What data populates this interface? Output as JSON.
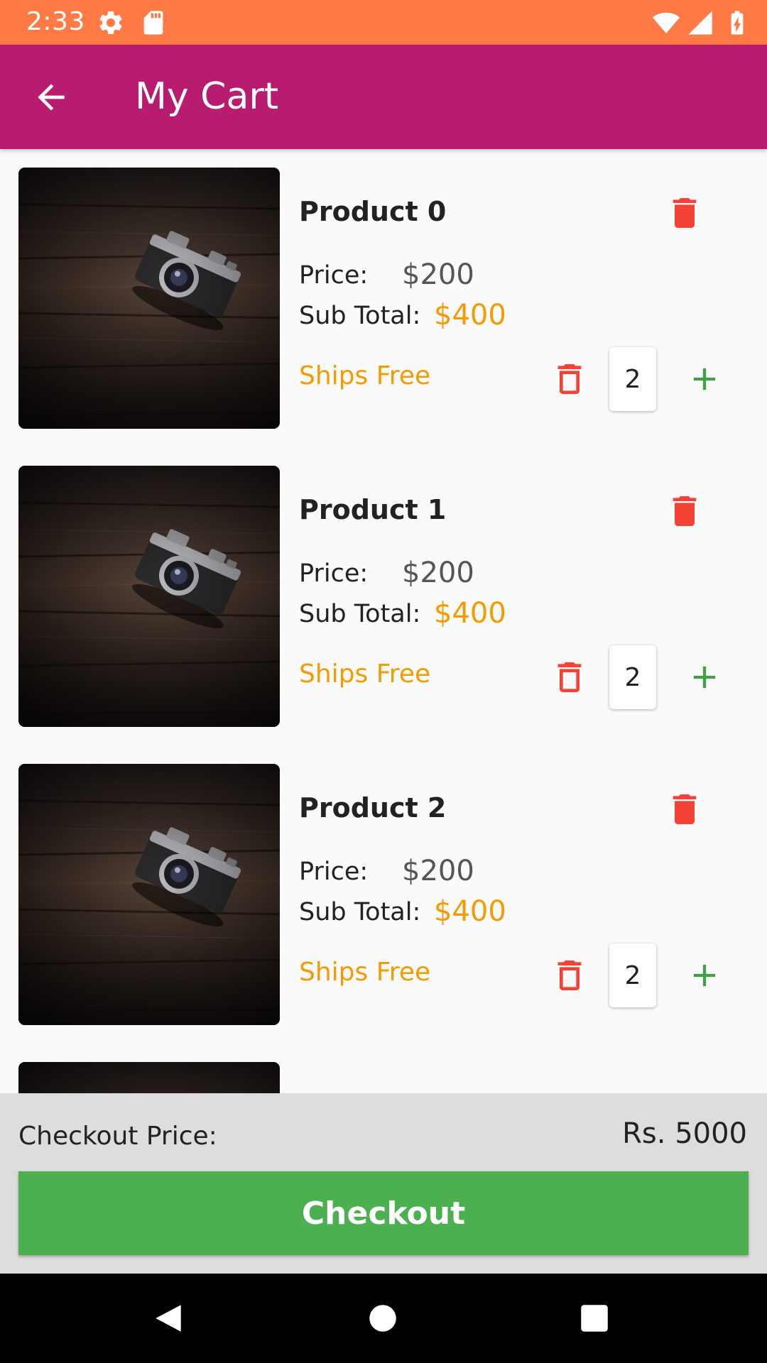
{
  "status_bar": {
    "time": "2:33",
    "icons": [
      "gear-icon",
      "sd-card-icon",
      "wifi-icon",
      "cell-signal-icon",
      "battery-charging-icon"
    ]
  },
  "app_bar": {
    "title": "My Cart",
    "back_icon": "arrow-left-icon"
  },
  "colors": {
    "status_bar": "#ff7a45",
    "app_bar": "#b71c6f",
    "accent_orange": "#f59a00",
    "delete_red": "#f44336",
    "add_green": "#4caf50",
    "checkout_button": "#4caf50"
  },
  "cart": {
    "items": [
      {
        "name": "Product 0",
        "price_label": "Price:",
        "price": "$200",
        "subtotal_label": "Sub Total:",
        "subtotal": "$400",
        "shipping": "Ships Free",
        "quantity": "2"
      },
      {
        "name": "Product 1",
        "price_label": "Price:",
        "price": "$200",
        "subtotal_label": "Sub Total:",
        "subtotal": "$400",
        "shipping": "Ships Free",
        "quantity": "2"
      },
      {
        "name": "Product 2",
        "price_label": "Price:",
        "price": "$200",
        "subtotal_label": "Sub Total:",
        "subtotal": "$400",
        "shipping": "Ships Free",
        "quantity": "2"
      }
    ]
  },
  "checkout": {
    "label": "Checkout Price:",
    "total": "Rs. 5000",
    "button_label": "Checkout"
  },
  "nav_bar": {
    "icons": [
      "nav-back-icon",
      "nav-home-icon",
      "nav-recents-icon"
    ]
  }
}
